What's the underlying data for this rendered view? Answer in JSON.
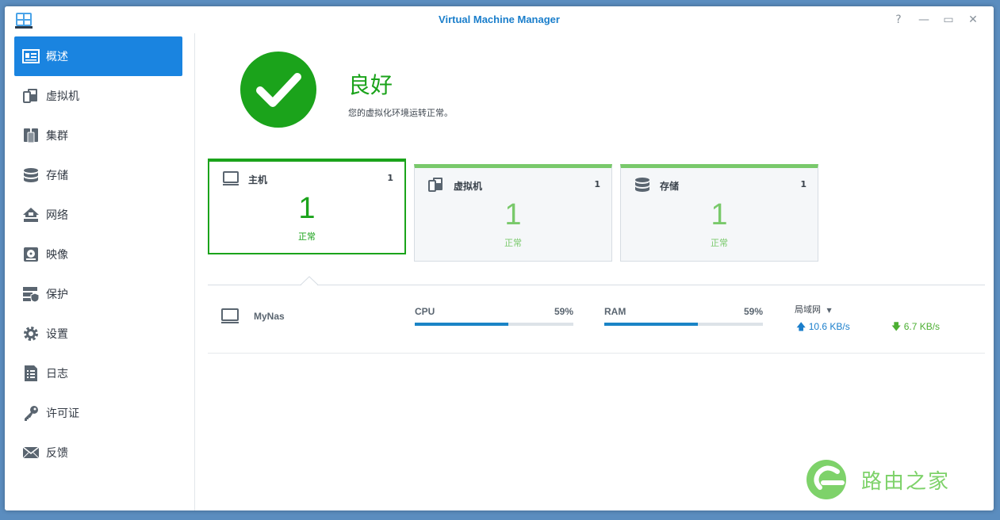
{
  "window": {
    "title": "Virtual Machine Manager",
    "controls": {
      "help": "?",
      "minimize": "—",
      "maximize": "▭",
      "close": "✕"
    }
  },
  "sidebar": {
    "items": [
      {
        "label": "概述",
        "icon": "overview-icon",
        "active": true
      },
      {
        "label": "虚拟机",
        "icon": "virtual-machine-icon"
      },
      {
        "label": "集群",
        "icon": "cluster-icon"
      },
      {
        "label": "存储",
        "icon": "storage-icon"
      },
      {
        "label": "网络",
        "icon": "network-icon"
      },
      {
        "label": "映像",
        "icon": "image-icon"
      },
      {
        "label": "保护",
        "icon": "protection-icon"
      },
      {
        "label": "设置",
        "icon": "settings-gear-icon"
      },
      {
        "label": "日志",
        "icon": "log-icon"
      },
      {
        "label": "许可证",
        "icon": "license-key-icon"
      },
      {
        "label": "反馈",
        "icon": "feedback-envelope-icon"
      }
    ]
  },
  "status": {
    "title": "良好",
    "description": "您的虚拟化环境运转正常。",
    "icon": "check-circle-icon",
    "color": "#1ba31b"
  },
  "cards": [
    {
      "label": "主机",
      "count": "1",
      "value": "1",
      "state": "正常",
      "icon": "monitor-icon"
    },
    {
      "label": "虚拟机",
      "count": "1",
      "value": "1",
      "state": "正常",
      "icon": "virtual-machine-icon"
    },
    {
      "label": "存储",
      "count": "1",
      "value": "1",
      "state": "正常",
      "icon": "storage-icon"
    }
  ],
  "host": {
    "name": "MyNas",
    "cpu": {
      "label": "CPU",
      "value": "59%",
      "fraction": 0.59
    },
    "ram": {
      "label": "RAM",
      "value": "59%",
      "fraction": 0.59
    },
    "network": {
      "selector": "局域网",
      "upload": "10.6 KB/s",
      "download": "6.7 KB/s"
    }
  },
  "watermark": {
    "text": "路由之家"
  },
  "colors": {
    "accent": "#1a84e0",
    "ok_green": "#1ba31b",
    "light_green": "#79c96b",
    "bar_blue": "#1a84c6"
  }
}
